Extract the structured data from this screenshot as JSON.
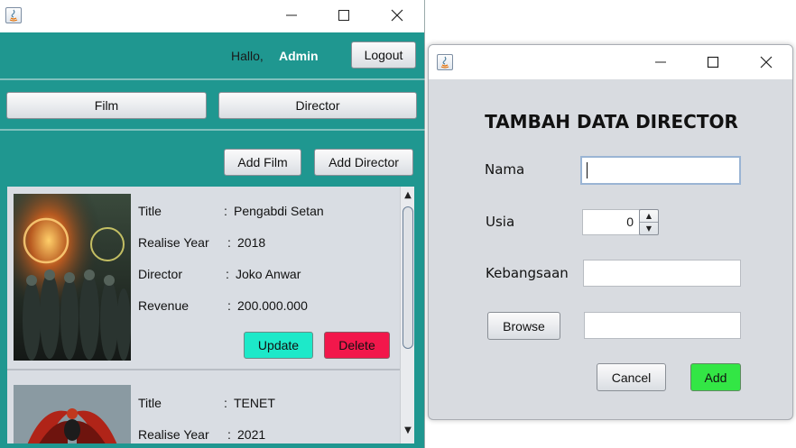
{
  "main_window": {
    "greeting": "Hallo,",
    "username": "Admin",
    "logout_label": "Logout",
    "nav": {
      "film_label": "Film",
      "director_label": "Director"
    },
    "actions": {
      "add_film_label": "Add Film",
      "add_director_label": "Add Director"
    },
    "films": [
      {
        "title_label": "Title",
        "title": "Pengabdi Setan",
        "year_label": "Realise Year",
        "year": "2018",
        "director_label": "Director",
        "director": "Joko Anwar",
        "revenue_label": "Revenue",
        "revenue": "200.000.000",
        "update_label": "Update",
        "delete_label": "Delete"
      },
      {
        "title_label": "Title",
        "title": "TENET",
        "year_label": "Realise Year",
        "year": "2021"
      }
    ],
    "colors": {
      "background": "#1f9790",
      "update_button": "#1de9c9",
      "delete_button": "#f2174b"
    }
  },
  "dialog": {
    "heading": "TAMBAH DATA DIRECTOR",
    "nama_label": "Nama",
    "nama_value": "",
    "usia_label": "Usia",
    "usia_value": "0",
    "kebangsaan_label": "Kebangsaan",
    "kebangsaan_value": "",
    "browse_label": "Browse",
    "browse_path": "",
    "cancel_label": "Cancel",
    "add_label": "Add",
    "colors": {
      "add_button": "#33e645"
    }
  },
  "colon": ":"
}
